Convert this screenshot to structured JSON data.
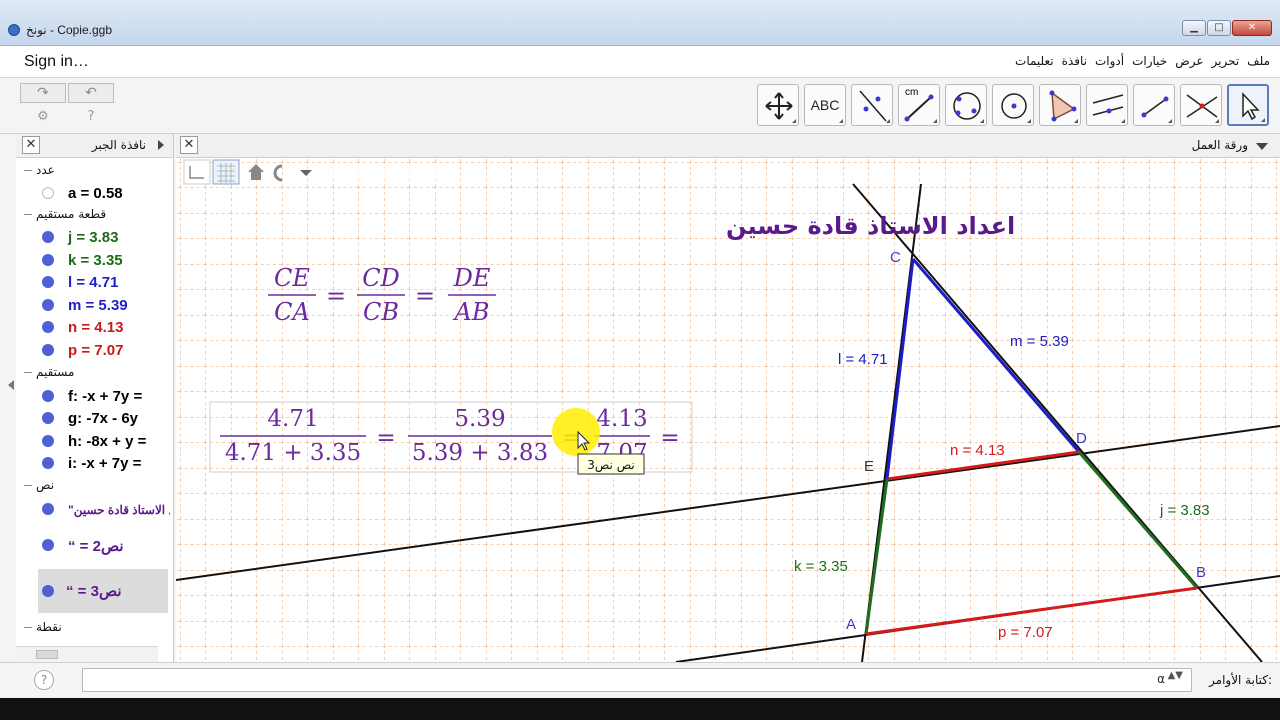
{
  "window": {
    "title": "نونخ - Copie.ggb",
    "btn_min": "▁",
    "btn_max": "□",
    "btn_close": "✕"
  },
  "menubar": {
    "sign_in": "Sign in…",
    "items": [
      "ملف",
      "تحرير",
      "عرض",
      "خيارات",
      "أدوات",
      "نافذة",
      "تعليمات"
    ]
  },
  "toolbar": {
    "undo_glyph": "↶",
    "redo_glyph": "↷",
    "settings_glyph": "⚙",
    "help_glyph": "?",
    "text_tool_label": "ABC",
    "distance_tool_label": "cm"
  },
  "algebra": {
    "title": "نافذة الجبر",
    "close_glyph": "✕",
    "categories": [
      {
        "name": "عدد"
      },
      {
        "name": "قطعة مستقيم"
      },
      {
        "name": "مستقيم"
      },
      {
        "name": "نص"
      },
      {
        "name": "نقطة"
      }
    ],
    "items": [
      {
        "text": "a = 0.58",
        "color": "#000000",
        "dot": "#ffffff"
      },
      {
        "text": "j = 3.83",
        "color": "#1b6b1b",
        "dot": "#4f5fd6"
      },
      {
        "text": "k = 3.35",
        "color": "#1b6b1b",
        "dot": "#4f5fd6"
      },
      {
        "text": "l = 4.71",
        "color": "#2121c7",
        "dot": "#4f5fd6"
      },
      {
        "text": "m = 5.39",
        "color": "#2121c7",
        "dot": "#4f5fd6"
      },
      {
        "text": "n = 4.13",
        "color": "#c41c1c",
        "dot": "#4f5fd6"
      },
      {
        "text": "p = 7.07",
        "color": "#c41c1c",
        "dot": "#4f5fd6"
      },
      {
        "text": "f: -x + 7y =",
        "color": "#000000",
        "dot": "#4f5fd6"
      },
      {
        "text": "g: -7x - 6y",
        "color": "#000000",
        "dot": "#4f5fd6"
      },
      {
        "text": "h: -8x + y =",
        "color": "#000000",
        "dot": "#4f5fd6"
      },
      {
        "text": "i: -x + 7y =",
        "color": "#000000",
        "dot": "#4f5fd6"
      },
      {
        "text": "\"اعداد الاستاذ قادة حسين\"",
        "color": "#5b1a8c",
        "dot": "#4f5fd6"
      },
      {
        "text": "“  =  نص2",
        "color": "#5b1a8c",
        "dot": "#4f5fd6"
      },
      {
        "text": "“  =  نص3",
        "color": "#5b1a8c",
        "dot": "#4f5fd6"
      }
    ]
  },
  "graphics": {
    "title": "ورقة العمل",
    "close_glyph": "✕",
    "heading": "اعداد الاستاذ قادة حسين",
    "ratio": {
      "n1": "CE",
      "d1": "CA",
      "n2": "CD",
      "d2": "CB",
      "n3": "DE",
      "d3": "AB",
      "eq": "="
    },
    "numeric": {
      "n1": "4.71",
      "d1": "4.71 + 3.35",
      "n2": "5.39",
      "d2": "5.39 + 3.83",
      "n3": "4.13",
      "d3": "7.07",
      "eq": "="
    },
    "tooltip": "نص نص3",
    "points": {
      "A": "A",
      "B": "B",
      "C": "C",
      "D": "D",
      "E": "E"
    },
    "segment_labels": {
      "l": "l = 4.71",
      "m": "m = 5.39",
      "n": "n = 4.13",
      "j": "j = 3.83",
      "k": "k = 3.35",
      "p": "p = 7.07"
    },
    "colors": {
      "blue": "#1c1cc8",
      "green": "#1f6e1f",
      "red": "#d41a1a",
      "grid": "#f0a060",
      "purple": "#5b1a8c",
      "point_label": "#3a3ad0"
    }
  },
  "inputbar": {
    "label": "كتابة الأوامر:",
    "alpha": "α",
    "updown": "▲▼",
    "help_glyph": "?"
  }
}
